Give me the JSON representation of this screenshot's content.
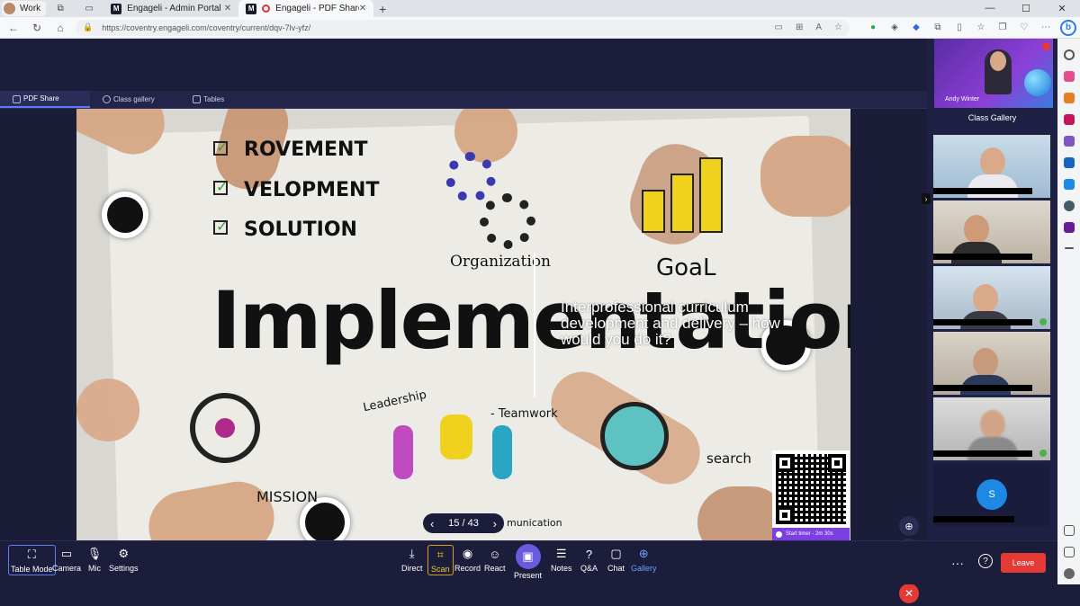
{
  "browser": {
    "profile_label": "Work",
    "tabs": [
      {
        "title": "Engageli - Admin Portal",
        "favicon": "M"
      },
      {
        "title": "Engageli - PDF Share",
        "favicon": "recording"
      }
    ],
    "new_tab": "+",
    "url": "https://coventry.engageli.com/coventry/current/dqv-7lv-yfz/",
    "window_controls": [
      "—",
      "☐",
      "✕"
    ]
  },
  "app": {
    "subtabs": [
      {
        "label": "PDF Share",
        "active": true
      },
      {
        "label": "Class gallery",
        "active": false
      },
      {
        "label": "Tables",
        "active": false
      }
    ],
    "slide": {
      "overlay_text": "Interprofessional curriculum development and delivery – how would you do it?",
      "page_indicator": "15 / 43",
      "artwork_words": [
        "ROVEMENT",
        "VELOPMENT",
        "SOLUTION",
        "Organization",
        "GoaL",
        "Implementation",
        "Leadership",
        "- Teamwork",
        "MISSION",
        "search",
        "munication"
      ],
      "qr_timer_label": "Start timer - 2m 30s"
    },
    "host": {
      "name": "Andy Winter"
    },
    "gallery_title": "Class Gallery",
    "s_avatar_initial": "S",
    "toolbar": {
      "left": [
        {
          "label": "Table Mode",
          "icon": "table-mode-icon"
        },
        {
          "label": "Camera",
          "icon": "camera-icon"
        },
        {
          "label": "Mic",
          "icon": "mic-icon"
        },
        {
          "label": "Settings",
          "icon": "gear-icon"
        }
      ],
      "center": [
        {
          "label": "Direct",
          "icon": "download-icon"
        },
        {
          "label": "Scan",
          "icon": "scan-icon"
        },
        {
          "label": "Record",
          "icon": "record-icon"
        },
        {
          "label": "React",
          "icon": "smile-icon"
        },
        {
          "label": "Present",
          "icon": "present-icon"
        },
        {
          "label": "Notes",
          "icon": "notes-icon"
        },
        {
          "label": "Q&A",
          "icon": "qa-icon"
        },
        {
          "label": "Chat",
          "icon": "chat-icon"
        },
        {
          "label": "Gallery",
          "icon": "gallery-icon"
        }
      ],
      "leave_label": "Leave",
      "more_label": "···",
      "help_label": "?"
    }
  },
  "colors": {
    "app_bg": "#1c1d3b",
    "accent": "#5b7cf5",
    "leave": "#e53935",
    "present": "#6a5ae0",
    "scan": "#d4a017"
  }
}
